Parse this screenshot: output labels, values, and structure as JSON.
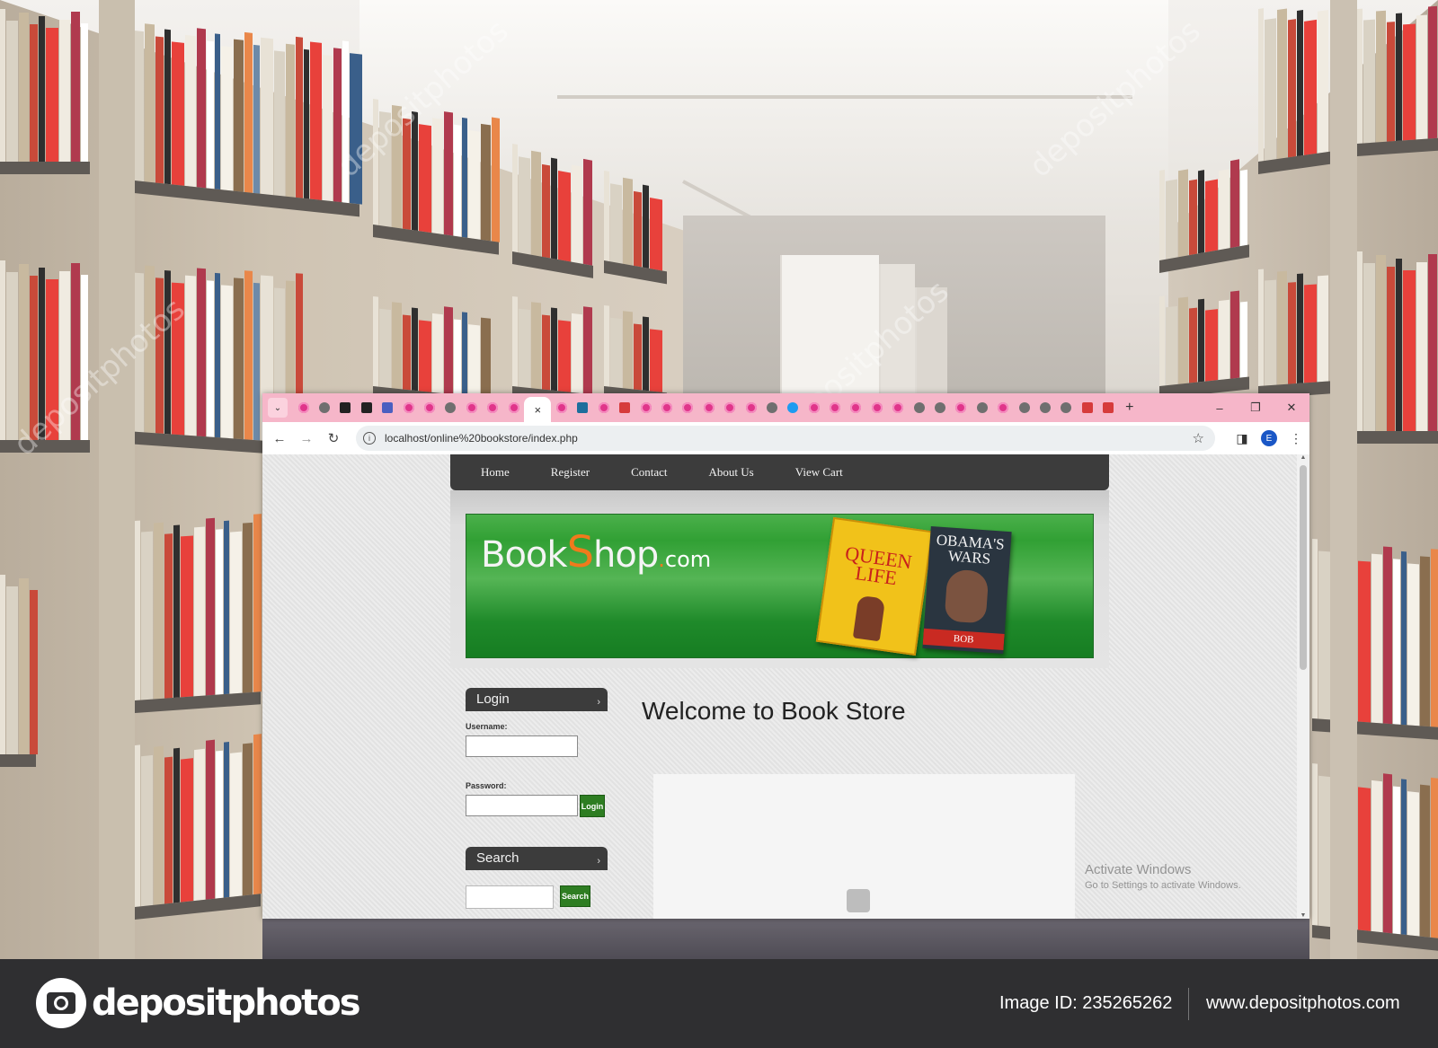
{
  "browser": {
    "url": "localhost/online%20bookstore/index.php",
    "active_tab_close": "×",
    "new_tab": "+",
    "window_controls": {
      "minimize": "–",
      "restore": "❐",
      "close": "✕"
    },
    "profile_initial": "E",
    "favicons": [
      "pink",
      "grey",
      "dark",
      "dark",
      "gem",
      "pink",
      "pink",
      "grey",
      "pink",
      "pink",
      "pink",
      "ACTIVE",
      "pink",
      "teal",
      "pink",
      "red",
      "pink",
      "pink",
      "pink",
      "pink",
      "pink",
      "pink",
      "grey",
      "blue",
      "pink",
      "pink",
      "pink",
      "pink",
      "pink",
      "grey",
      "grey",
      "pink",
      "grey",
      "pink",
      "grey",
      "grey",
      "grey",
      "red",
      "red"
    ]
  },
  "site": {
    "menu": [
      "Home",
      "Register",
      "Contact",
      "About Us",
      "View Cart"
    ],
    "logo": {
      "part1": "Book",
      "s": "S",
      "part2": "hop",
      "dot": ".",
      "com": "com"
    },
    "cover1_title": "QUEEN LIFE",
    "cover2_title": "OBAMA'S WARS",
    "cover2_author": "BOB WOODWARD",
    "login": {
      "title": "Login",
      "username_label": "Username:",
      "password_label": "Password:",
      "button": "Login"
    },
    "search": {
      "title": "Search",
      "button": "Search"
    },
    "welcome": "Welcome to Book Store"
  },
  "os_overlay": {
    "line1": "Activate Windows",
    "line2": "Go to Settings to activate Windows."
  },
  "watermark": {
    "text": "depositphotos",
    "brand": "depositphotos",
    "image_id": "Image ID: 235265262",
    "site": "www.depositphotos.com"
  }
}
